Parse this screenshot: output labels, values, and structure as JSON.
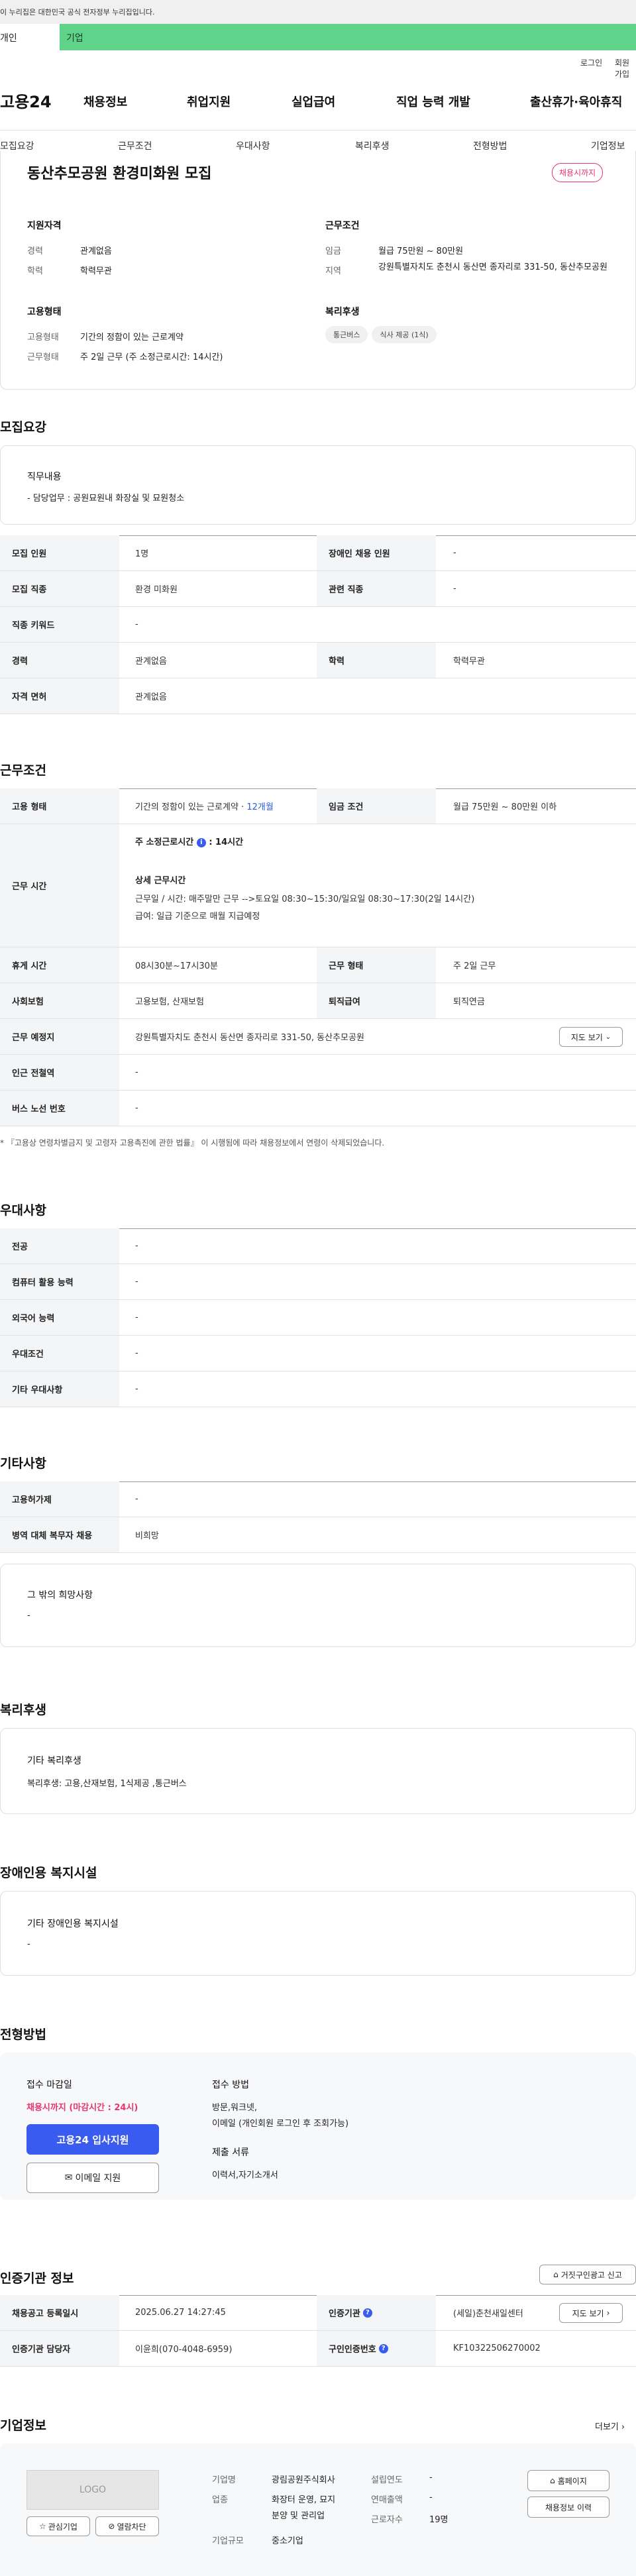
{
  "gov_banner": "이 누리집은 대한민국 공식 전자정부 누리집입니다.",
  "user_type": {
    "personal": "개인",
    "business": "기업"
  },
  "util": {
    "login": "로그인",
    "join": "회원가입"
  },
  "logo": "고용24",
  "gnb": [
    "채용정보",
    "취업지원",
    "실업급여",
    "직업 능력 개발",
    "출산휴가·육아휴직"
  ],
  "subnav": [
    "모집요강",
    "근무조건",
    "우대사항",
    "복리후생",
    "전형방법",
    "기업정보"
  ],
  "summary": {
    "title": "동산추모공원 환경미화원 모집",
    "badge": "채용시까지",
    "qual_title": "지원자격",
    "career_label": "경력",
    "career_value": "관계없음",
    "edu_label": "학력",
    "edu_value": "학력무관",
    "cond_title": "근무조건",
    "wage_label": "임금",
    "wage_value": "월급 75만원 ~ 80만원",
    "region_label": "지역",
    "region_value": "강원특별자치도 춘천시 동산면 종자리로 331-50, 동산추모공원",
    "emp_title": "고용형태",
    "emptype_label": "고용형태",
    "emptype_value": "기간의 정함이 있는 근로계약",
    "worktype_label": "근무형태",
    "worktype_value": "주 2일 근무 (주 소정근로시간: 14시간)",
    "welfare_title": "복리후생",
    "welfare_chips": [
      "통근버스",
      "식사 제공 (1식)"
    ]
  },
  "recruit": {
    "title": "모집요강",
    "duty_title": "직무내용",
    "duty_text": "- 담당업무 :  공원묘원내 화장실 및 묘원청소",
    "rows": [
      {
        "k1": "모집 인원",
        "v1": "1명",
        "k2": "장애인 채용 인원",
        "v2": "-"
      },
      {
        "k1": "모집 직종",
        "v1": "환경 미화원",
        "k2": "관련 직종",
        "v2": "-"
      },
      {
        "k1": "직종 키워드",
        "v1": "-"
      },
      {
        "k1": "경력",
        "v1": "관계없음",
        "k2": "학력",
        "v2": "학력무관"
      },
      {
        "k1": "자격 면허",
        "v1": "관계없음"
      }
    ]
  },
  "conditions": {
    "title": "근무조건",
    "emptype_k": "고용 형태",
    "emptype_v": "기간의 정함이 있는 근로계약 · ",
    "emptype_months": "12개월",
    "wagecond_k": "임금 조건",
    "wagecond_v": "월급 75만원 ~ 80만원 이하",
    "worktime_k": "근무 시간",
    "worktime_hours": "주 소정근로시간",
    "worktime_hours_icon": "info-icon",
    "worktime_hours_v": ": 14시간",
    "worktime_detail_title": "상세 근무시간",
    "worktime_detail1": "근무일 / 시간: 매주말만 근무 -->토요일 08:30~15:30/일요일 08:30~17:30(2일 14시간)",
    "worktime_detail2": "급여: 일급 기준으로 매월 지급예정",
    "rest_k": "휴게 시간",
    "rest_v": "08시30분~17시30분",
    "form_k": "근무 형태",
    "form_v": "주 2일 근무",
    "ins_k": "사회보험",
    "ins_v": "고용보험, 산재보험",
    "sev_k": "퇴직급여",
    "sev_v": "퇴직연금",
    "place_k": "근무 예정지",
    "place_v": "강원특별자치도 춘천시 동산면 종자리로 331-50, 동산추모공원",
    "map_btn": "지도 보기",
    "subway_k": "인근 전철역",
    "subway_v": "-",
    "bus_k": "버스 노선 번호",
    "bus_v": "-",
    "note": "* 『고용상 연령차별금지 및 고령자 고용촉진에 관한 법률』 이 시행됨에 따라 채용정보에서 연령이 삭제되었습니다."
  },
  "preference": {
    "title": "우대사항",
    "rows": [
      {
        "k": "전공",
        "v": "-"
      },
      {
        "k": "컴퓨터 활용 능력",
        "v": "-"
      },
      {
        "k": "외국어 능력",
        "v": "-"
      },
      {
        "k": "우대조건",
        "v": "-"
      },
      {
        "k": "기타 우대사항",
        "v": "-"
      }
    ]
  },
  "etc": {
    "title": "기타사항",
    "rows": [
      {
        "k": "고용허가제",
        "v": "-"
      },
      {
        "k": "병역 대체 복무자 채용",
        "v": "비희망"
      }
    ],
    "wish_title": "그 밖의 희망사항",
    "wish_text": "-"
  },
  "welfare": {
    "title": "복리후생",
    "box_title": "기타 복리후생",
    "box_text": "복리후생: 고용,산재보험, 1식제공 ,통근버스"
  },
  "disability": {
    "title": "장애인용 복지시설",
    "box_title": "기타 장애인용 복지시설",
    "box_text": "-"
  },
  "selection": {
    "title": "전형방법",
    "deadline_title": "접수 마감일",
    "deadline_value": "채용시까지 (마감시간 : 24시)",
    "apply_btn": "고용24 입사지원",
    "email_btn": "이메일 지원",
    "method_title": "접수 방법",
    "method_line1": "방문,워크넷,",
    "method_line2": "이메일 (개인회원 로그인 후 조회가능)",
    "docs_title": "제출 서류",
    "docs_text": "이력서,자기소개서"
  },
  "cert": {
    "title": "인증기관 정보",
    "report_btn": "거짓구인광고 신고",
    "reg_k": "채용공고 등록일시",
    "reg_v": "2025.06.27 14:27:45",
    "org_k": "인증기관",
    "org_v": "(세일)춘천새일센터",
    "detail_btn": "지도 보기",
    "mgr_k": "인증기관 담당자",
    "mgr_v": "이윤희(070-4048-6959)",
    "no_k": "구인인증번호",
    "no_v": "KF10322506270002"
  },
  "company": {
    "title": "기업정보",
    "more": "더보기",
    "logo_text": "LOGO",
    "interest_btn": "관심기업",
    "block_btn": "열람차단",
    "name_k": "기업명",
    "name_v": "광림공원주식회사",
    "biz_k": "업종",
    "biz_v1": "화장터 운영, 묘지",
    "biz_v2": "분양 및 관리업",
    "size_k": "기업규모",
    "size_v": "중소기업",
    "est_k": "설립연도",
    "est_v": "-",
    "sales_k": "연매출액",
    "sales_v": "-",
    "emp_k": "근로자수",
    "emp_v": "19명",
    "home_btn": "홈페이지",
    "history_btn": "채용정보 이력"
  }
}
